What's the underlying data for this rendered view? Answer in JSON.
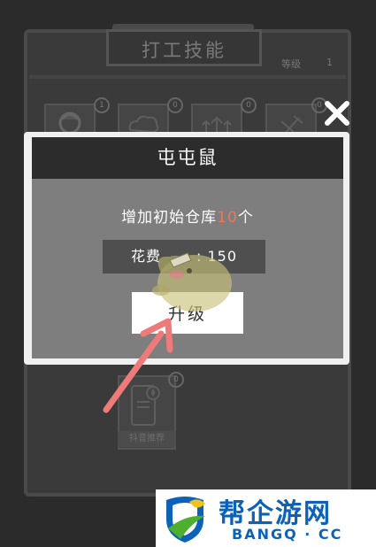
{
  "background": {
    "title": "打工技能",
    "level_label": "等级",
    "level_value": "1",
    "skill_cards": [
      {
        "badge": "1",
        "icon": "person-icon"
      },
      {
        "badge": "0",
        "icon": "cloud-icon"
      },
      {
        "badge": "0",
        "icon": "arrows-up-icon"
      },
      {
        "badge": "0",
        "icon": "tools-icon"
      }
    ],
    "bottom_card": {
      "badge": "0",
      "label": "抖音推荐",
      "icon": "phone-fire-icon"
    }
  },
  "modal": {
    "title": "屯屯鼠",
    "description_prefix": "增加初始仓库",
    "description_value": "10",
    "description_suffix": "个",
    "cost_label": "花费",
    "cost_value": "150",
    "upgrade_label": "升级",
    "close_icon": "close-icon"
  },
  "watermark": {
    "name": "帮企游网",
    "domain": "BANGQ · CC"
  },
  "colors": {
    "highlight": "#ee7755",
    "modal_header": "#2c2c2c",
    "modal_body": "#7e7e7e",
    "watermark_blue": "#0c62b8",
    "watermark_green": "#4caf2e"
  }
}
